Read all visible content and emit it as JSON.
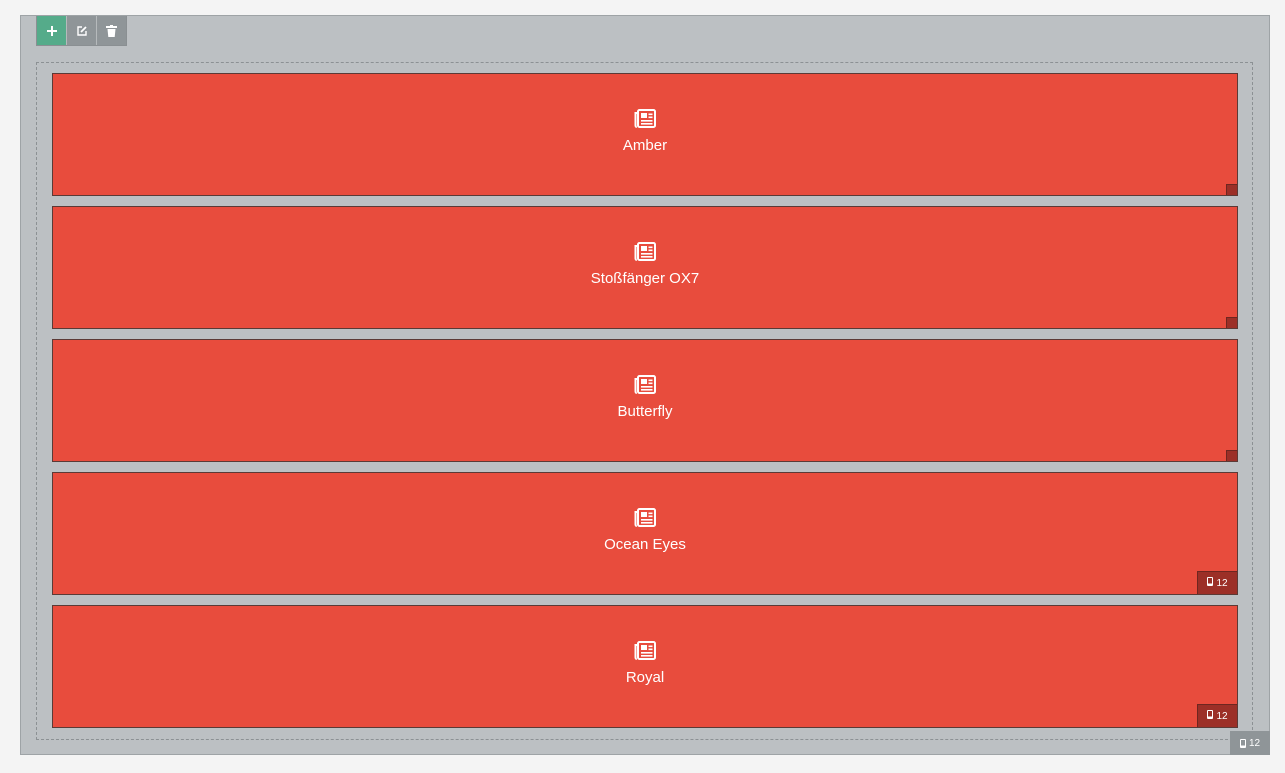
{
  "toolbar": {
    "add_icon": "plus-icon",
    "edit_icon": "edit-icon",
    "delete_icon": "trash-icon"
  },
  "rows": [
    {
      "label": "Amber",
      "icon": "newspaper-icon",
      "badge": null
    },
    {
      "label": "Stoßfänger OX7",
      "icon": "newspaper-icon",
      "badge": null
    },
    {
      "label": "Butterfly",
      "icon": "newspaper-icon",
      "badge": null
    },
    {
      "label": "Ocean Eyes",
      "icon": "newspaper-icon",
      "badge": "12"
    },
    {
      "label": "Royal",
      "icon": "newspaper-icon",
      "badge": "12"
    }
  ],
  "container_badge": "12",
  "colors": {
    "row_bg": "#e84c3d",
    "add_button": "#55ab8a",
    "toolbar_button": "#8f9598",
    "container_bg": "#bcc0c3"
  }
}
